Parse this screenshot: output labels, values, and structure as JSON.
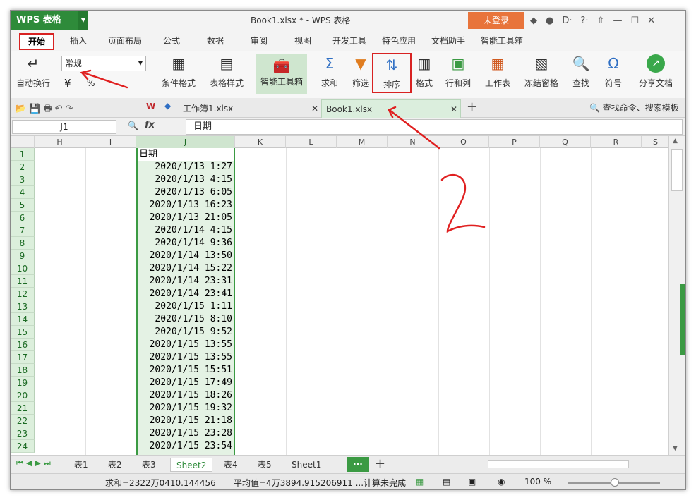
{
  "app": {
    "logo": "WPS 表格",
    "doc_title": "Book1.xlsx * - WPS 表格",
    "login": "未登录",
    "title_icons": [
      "◆",
      "●",
      "D·",
      "?·",
      "⇧",
      "—",
      "☐",
      "✕"
    ]
  },
  "menu": [
    "开始",
    "插入",
    "页面布局",
    "公式",
    "数据",
    "审阅",
    "视图",
    "开发工具",
    "特色应用",
    "文档助手",
    "智能工具箱"
  ],
  "ribbon": {
    "format_value": "常规",
    "wrap_label": "自动换行",
    "percent": "%",
    "buttons": [
      "条件格式",
      "表格样式",
      "智能工具箱",
      "求和",
      "筛选",
      "排序",
      "格式",
      "行和列",
      "工作表",
      "冻结窗格",
      "查找",
      "符号",
      "分享文档"
    ]
  },
  "tabs": {
    "tab1": "工作簿1.xlsx",
    "tab2": "Book1.xlsx",
    "search": "查找命令、搜索模板"
  },
  "formula": {
    "cell_ref": "J1",
    "fx": "fx",
    "value": "日期"
  },
  "columns": [
    "H",
    "I",
    "J",
    "K",
    "L",
    "M",
    "N",
    "O",
    "P",
    "Q",
    "R",
    "S"
  ],
  "rows": [
    "1",
    "2",
    "3",
    "4",
    "5",
    "6",
    "7",
    "8",
    "9",
    "10",
    "11",
    "12",
    "13",
    "14",
    "15",
    "16",
    "17",
    "18",
    "19",
    "20",
    "21",
    "22",
    "23",
    "24"
  ],
  "cells": [
    "日期",
    "2020/1/13 1:27",
    "2020/1/13 4:15",
    "2020/1/13 6:05",
    "2020/1/13 16:23",
    "2020/1/13 21:05",
    "2020/1/14 4:15",
    "2020/1/14 9:36",
    "2020/1/14 13:50",
    "2020/1/14 15:22",
    "2020/1/14 23:31",
    "2020/1/14 23:41",
    "2020/1/15 1:11",
    "2020/1/15 8:10",
    "2020/1/15 9:52",
    "2020/1/15 13:55",
    "2020/1/15 13:55",
    "2020/1/15 15:51",
    "2020/1/15 17:49",
    "2020/1/15 18:26",
    "2020/1/15 19:32",
    "2020/1/15 21:18",
    "2020/1/15 23:28",
    "2020/1/15 23:54"
  ],
  "sheets": [
    "表1",
    "表2",
    "表3",
    "Sheet2",
    "表4",
    "表5",
    "Sheet1"
  ],
  "status": {
    "sum": "求和=2322万0410.144456",
    "avg": "平均值=4万3894.915206911 ...",
    "calc": "计算未完成",
    "zoom": "100 %"
  },
  "annotation_text": "2"
}
